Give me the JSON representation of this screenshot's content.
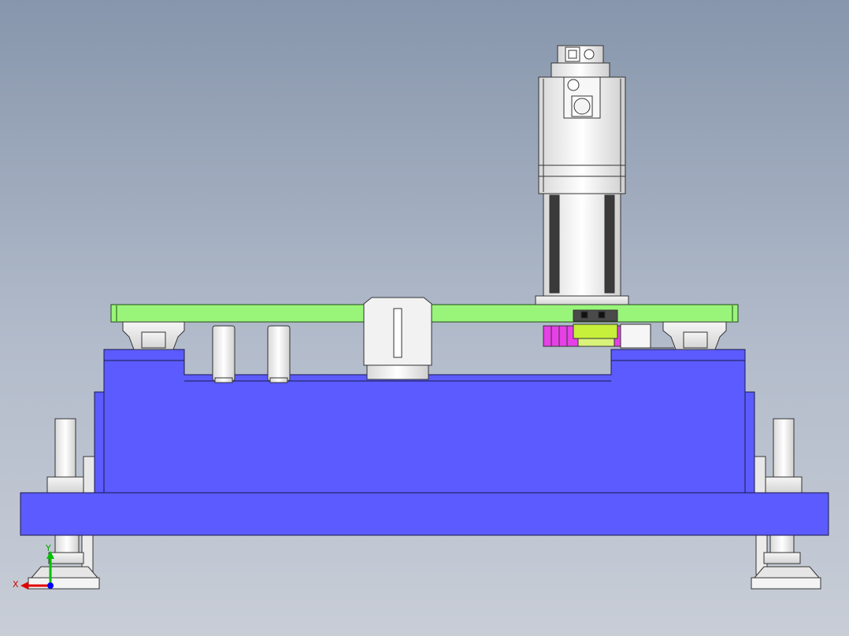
{
  "triad": {
    "x_label": "X",
    "y_label": "Y"
  },
  "colors": {
    "background_top": "#8796ac",
    "background_bottom": "#c8cdd6",
    "base_blue": "#5b5bff",
    "plate_green": "#99f57a",
    "gear_magenta": "#e640e6",
    "gear_yellow_green": "#c6f03a",
    "axis_x": "#e00000",
    "axis_y": "#00c000",
    "axis_z": "#0000ff"
  },
  "icons": [
    "coordinate-triad-icon"
  ]
}
